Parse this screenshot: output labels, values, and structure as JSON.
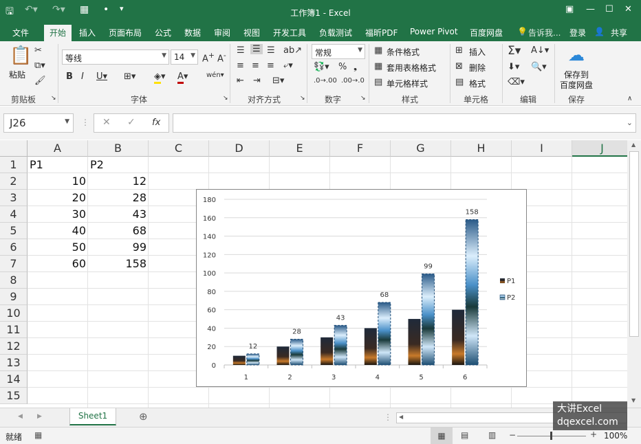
{
  "app": {
    "title": "工作簿1 - Excel"
  },
  "colors": {
    "excel_green": "#217346",
    "ribbon_bg": "#f3f3f3",
    "chart_p1": "#5a3a1a",
    "chart_p2": "#6aa8d8"
  },
  "tabs": [
    "文件",
    "开始",
    "插入",
    "页面布局",
    "公式",
    "数据",
    "审阅",
    "视图",
    "开发工具",
    "负载测试",
    "福昕PDF",
    "Power Pivot",
    "百度网盘"
  ],
  "tell_me": "告诉我...",
  "login": "登录",
  "share": "共享",
  "ribbon": {
    "clipboard": {
      "label": "剪贴板",
      "paste": "粘贴"
    },
    "font": {
      "label": "字体",
      "name": "等线",
      "size": "14"
    },
    "alignment": {
      "label": "对齐方式"
    },
    "number": {
      "label": "数字",
      "format": "常规"
    },
    "styles": {
      "label": "样式",
      "conditional": "条件格式",
      "table": "套用表格格式",
      "cell": "单元格样式"
    },
    "cells": {
      "label": "单元格",
      "insert": "插入",
      "delete": "删除",
      "format": "格式"
    },
    "editing": {
      "label": "编辑"
    },
    "save": {
      "label": "保存",
      "line1": "保存到",
      "line2": "百度网盘"
    }
  },
  "formula_bar": {
    "name_box": "J26",
    "fx": "fx",
    "value": ""
  },
  "sheet": {
    "columns": [
      "A",
      "B",
      "C",
      "D",
      "E",
      "F",
      "G",
      "H",
      "I",
      "J"
    ],
    "rows": [
      "1",
      "2",
      "3",
      "4",
      "5",
      "6",
      "7",
      "8",
      "9",
      "10",
      "11",
      "12",
      "13",
      "14",
      "15"
    ],
    "headers": [
      "P1",
      "P2"
    ],
    "data": [
      [
        "10",
        "12"
      ],
      [
        "20",
        "28"
      ],
      [
        "30",
        "43"
      ],
      [
        "40",
        "68"
      ],
      [
        "50",
        "99"
      ],
      [
        "60",
        "158"
      ]
    ]
  },
  "chart_data": {
    "type": "bar",
    "categories": [
      "1",
      "2",
      "3",
      "4",
      "5",
      "6"
    ],
    "series": [
      {
        "name": "P1",
        "values": [
          10,
          20,
          30,
          40,
          50,
          60
        ]
      },
      {
        "name": "P2",
        "values": [
          12,
          28,
          43,
          68,
          99,
          158
        ]
      }
    ],
    "data_labels": [
      "12",
      "28",
      "43",
      "68",
      "99",
      "158"
    ],
    "ylim": [
      0,
      180
    ],
    "yticks": [
      "0",
      "20",
      "40",
      "60",
      "80",
      "100",
      "120",
      "140",
      "160",
      "180"
    ],
    "grid": true,
    "legend": "right"
  },
  "sheet_tab": "Sheet1",
  "status": {
    "ready": "就绪",
    "zoom": "100%"
  },
  "watermark": {
    "line1": "大讲Excel",
    "line2": "dqexcel.com"
  }
}
